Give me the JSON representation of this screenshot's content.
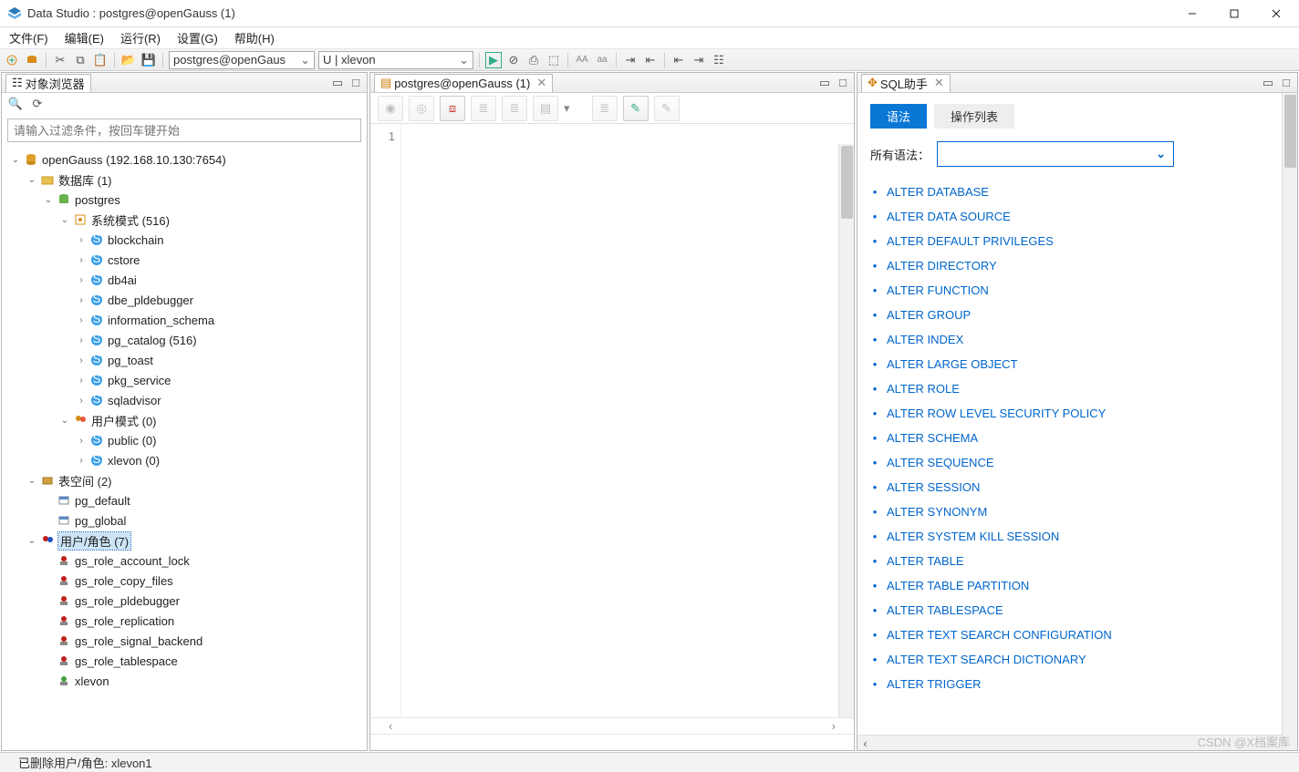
{
  "title": "Data Studio : postgres@openGauss (1)",
  "menu": [
    "文件(F)",
    "编辑(E)",
    "运行(R)",
    "设置(G)",
    "帮助(H)"
  ],
  "toolbar_combo1": "postgres@openGaus",
  "toolbar_combo2": "U | xlevon",
  "panels": {
    "browser_title": "对象浏览器",
    "editor_title": "postgres@openGauss (1)",
    "sql_title": "SQL助手"
  },
  "filter_placeholder": "请输入过滤条件，按回车键开始",
  "tree": {
    "root": "openGauss (192.168.10.130:7654)",
    "db_group": "数据库 (1)",
    "db": "postgres",
    "sys_schema": "系统模式 (516)",
    "sys_items": [
      "blockchain",
      "cstore",
      "db4ai",
      "dbe_pldebugger",
      "information_schema",
      "pg_catalog (516)",
      "pg_toast",
      "pkg_service",
      "sqladvisor"
    ],
    "user_schema": "用户模式 (0)",
    "user_items": [
      "public (0)",
      "xlevon (0)"
    ],
    "tablespace": "表空间 (2)",
    "tablespace_items": [
      "pg_default",
      "pg_global"
    ],
    "roles": "用户/角色 (7)",
    "roles_items": [
      "gs_role_account_lock",
      "gs_role_copy_files",
      "gs_role_pldebugger",
      "gs_role_replication",
      "gs_role_signal_backend",
      "gs_role_tablespace",
      "xlevon"
    ]
  },
  "editor": {
    "line1": "1"
  },
  "sql": {
    "tab_active": "语法",
    "tab_other": "操作列表",
    "filter_label": "所有语法：",
    "items": [
      "ALTER DATABASE",
      "ALTER DATA SOURCE",
      "ALTER DEFAULT PRIVILEGES",
      "ALTER DIRECTORY",
      "ALTER FUNCTION",
      "ALTER GROUP",
      "ALTER INDEX",
      "ALTER LARGE OBJECT",
      "ALTER ROLE",
      "ALTER ROW LEVEL SECURITY POLICY",
      "ALTER SCHEMA",
      "ALTER SEQUENCE",
      "ALTER SESSION",
      "ALTER SYNONYM",
      "ALTER SYSTEM KILL SESSION",
      "ALTER TABLE",
      "ALTER TABLE PARTITION",
      "ALTER TABLESPACE",
      "ALTER TEXT SEARCH CONFIGURATION",
      "ALTER TEXT SEARCH DICTIONARY",
      "ALTER TRIGGER"
    ]
  },
  "status": "已删除用户/角色: xlevon1",
  "watermark": "CSDN @X档案库"
}
